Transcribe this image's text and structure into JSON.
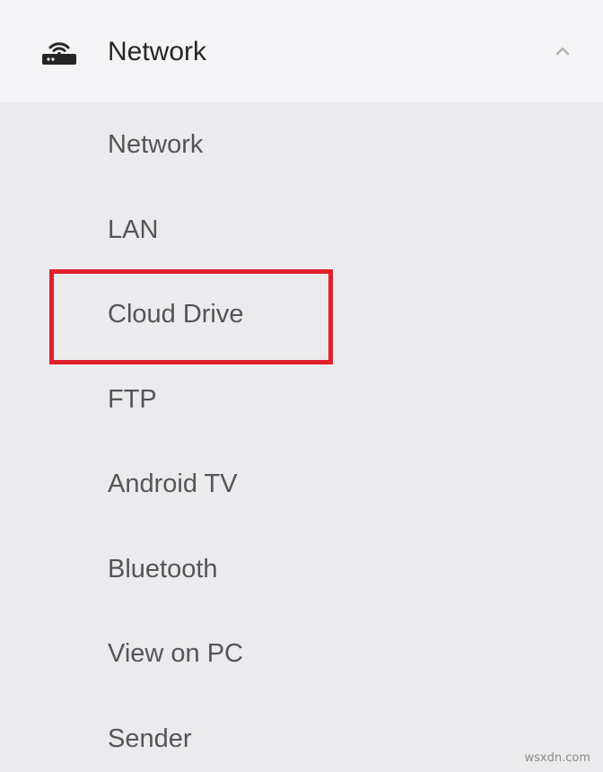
{
  "header": {
    "label": "Network",
    "icon": "router-icon",
    "chevron_icon": "chevron-up-icon",
    "expanded": true
  },
  "submenu": {
    "items": [
      {
        "label": "Network"
      },
      {
        "label": "LAN"
      },
      {
        "label": "Cloud Drive",
        "highlighted": true
      },
      {
        "label": "FTP"
      },
      {
        "label": "Android TV"
      },
      {
        "label": "Bluetooth"
      },
      {
        "label": "View on PC"
      },
      {
        "label": "Sender"
      }
    ]
  },
  "annotation": {
    "highlight_color": "#e0202a",
    "highlighted_item": "Cloud Drive"
  },
  "watermark": "wsxdn.com",
  "colors": {
    "header_bg": "#f4f4f6",
    "menu_bg": "#ebebed",
    "header_text": "#262626",
    "item_text": "#555558"
  }
}
